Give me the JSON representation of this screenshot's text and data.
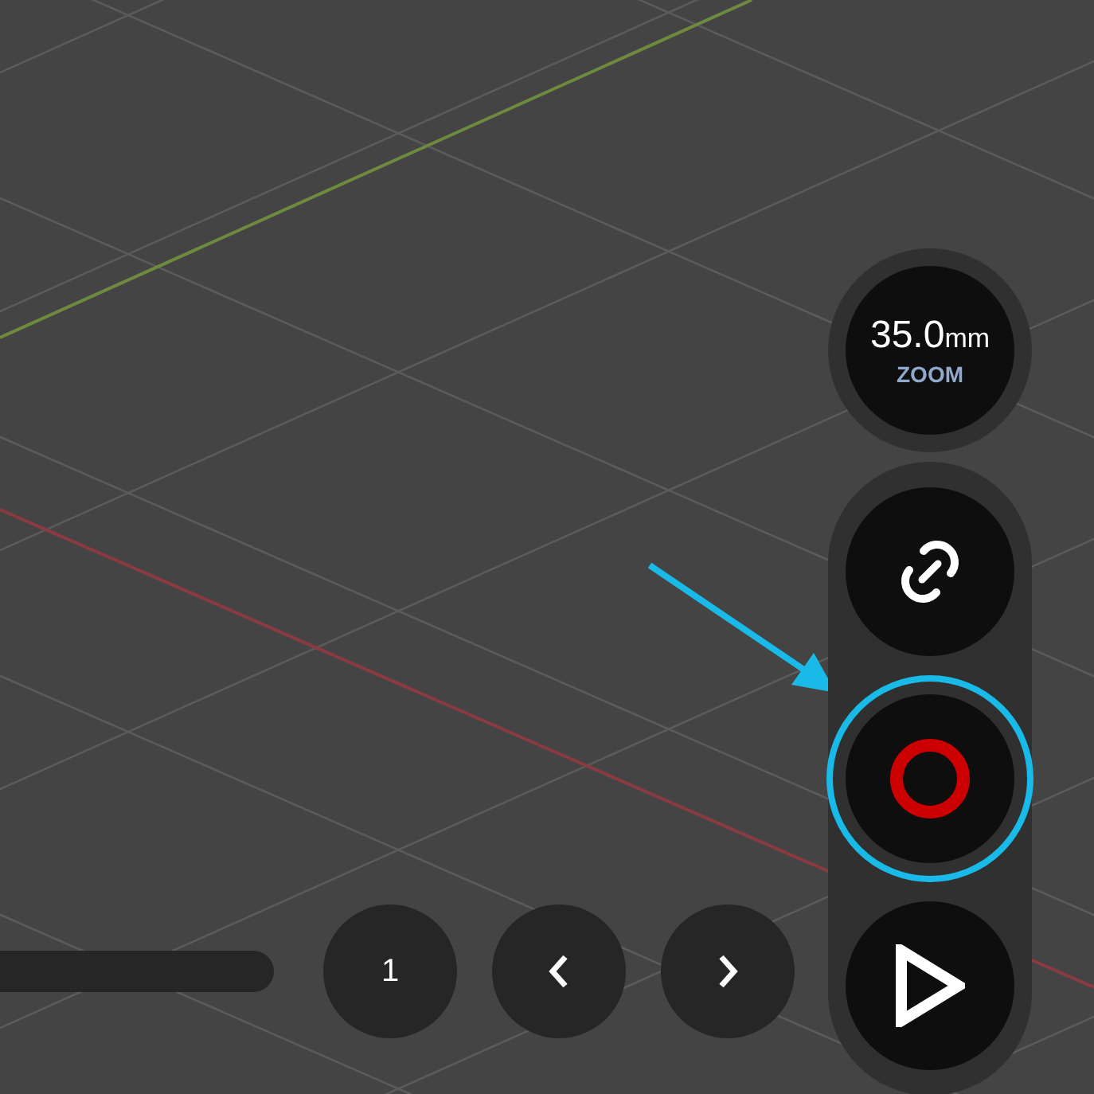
{
  "camera": {
    "focal_length": "35.0",
    "unit": "mm",
    "label": "ZOOM"
  },
  "tools": [
    {
      "kind": "link",
      "selected": false
    },
    {
      "kind": "record",
      "selected": true
    },
    {
      "kind": "play",
      "selected": false
    }
  ],
  "playback": {
    "frame": "1"
  }
}
